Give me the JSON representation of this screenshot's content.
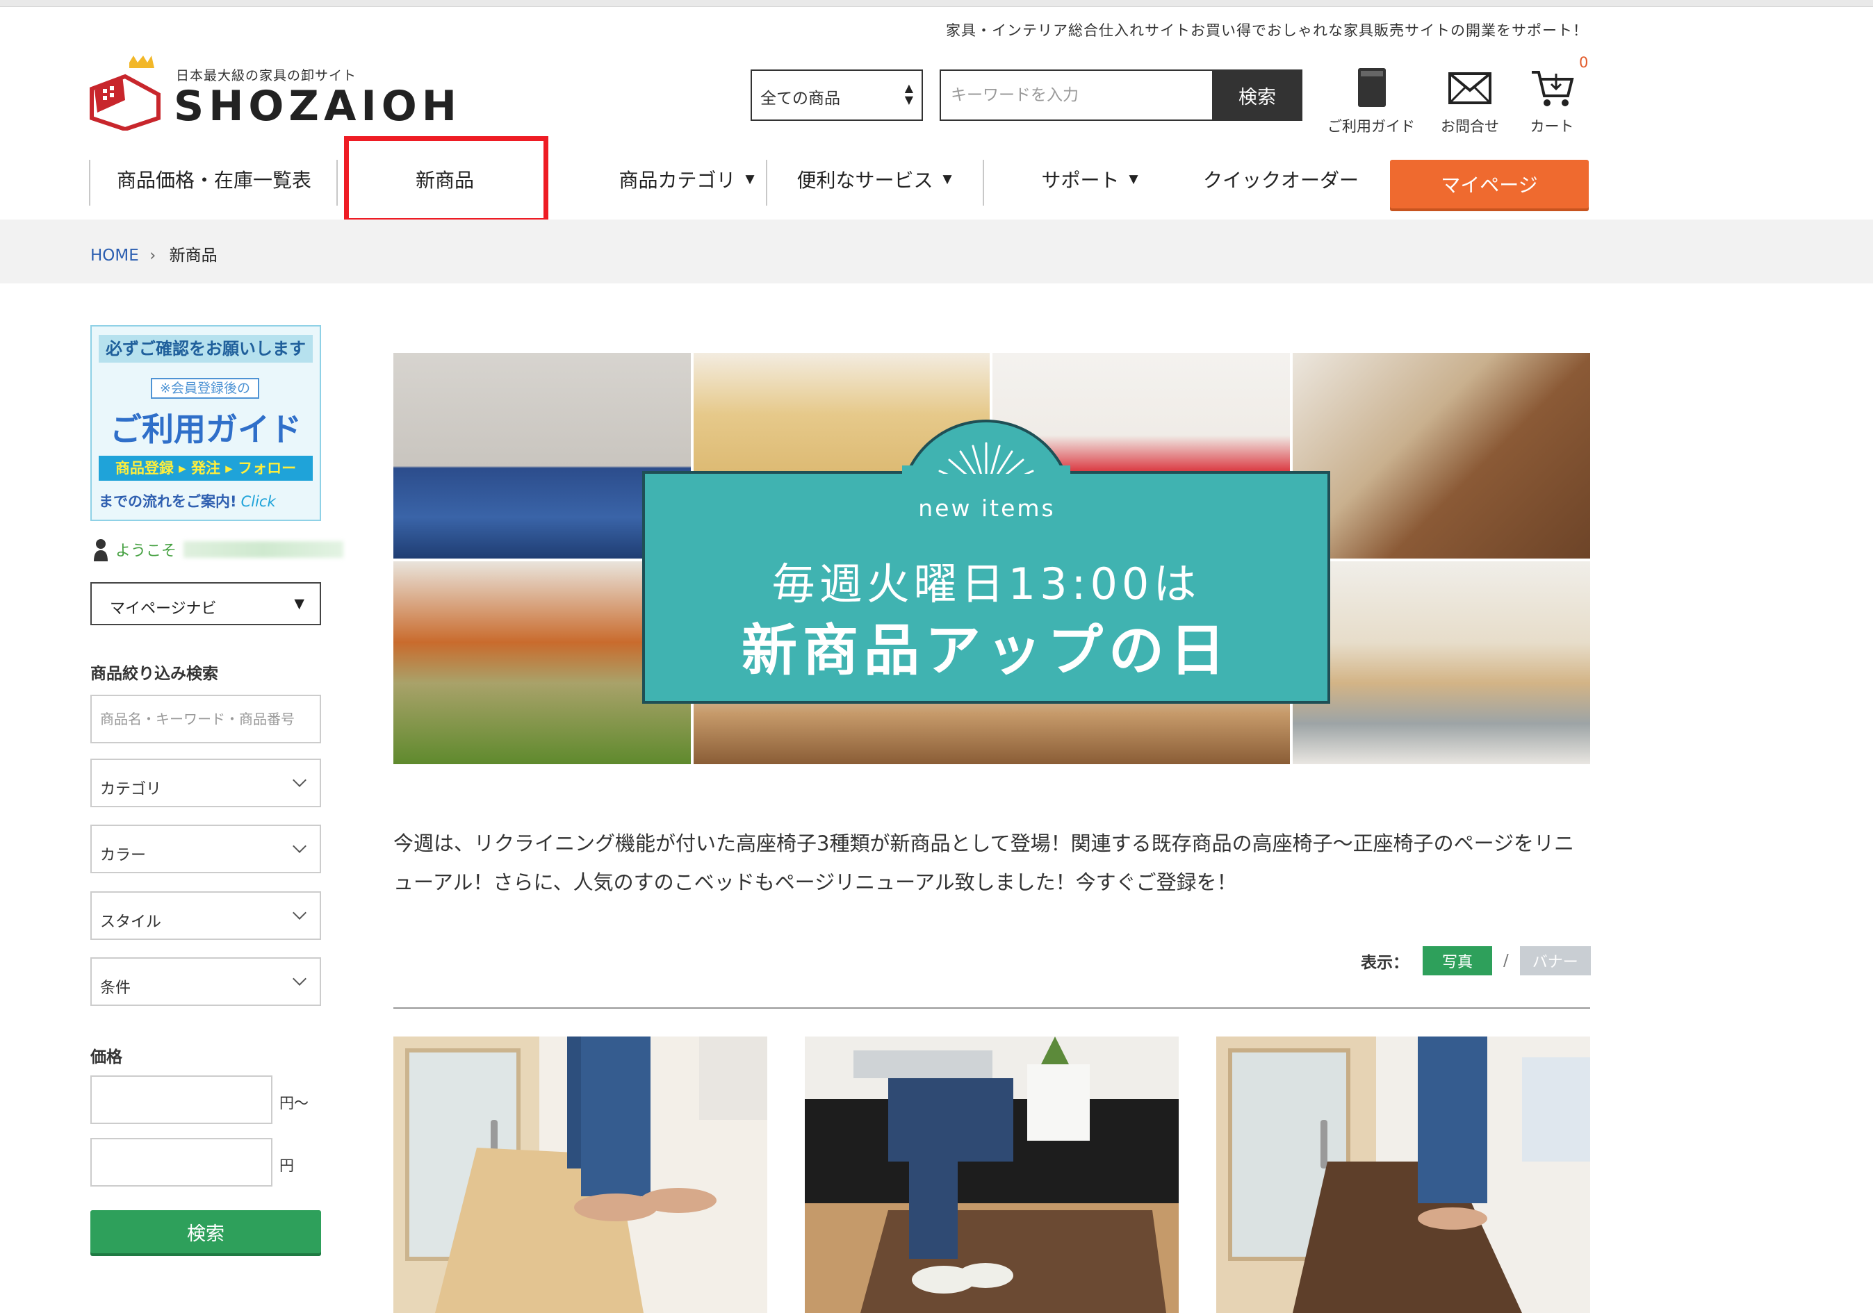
{
  "header": {
    "tagline": "家具・インテリア総合仕入れサイトお買い得でおしゃれな家具販売サイトの開業をサポート！",
    "logo_sub": "日本最大級の家具の卸サイト",
    "logo_name": "SHOZAIOH"
  },
  "search": {
    "category_value": "全ての商品",
    "keyword_placeholder": "キーワードを入力",
    "button_label": "検索"
  },
  "utility": {
    "guide_label": "ご利用ガイド",
    "contact_label": "お問合せ",
    "cart_label": "カート",
    "cart_count": "0"
  },
  "nav": {
    "items": [
      {
        "label": "商品価格・在庫一覧表"
      },
      {
        "label": "新商品"
      },
      {
        "label": "商品カテゴリ"
      },
      {
        "label": "便利なサービス"
      },
      {
        "label": "サポート"
      },
      {
        "label": "クイックオーダー"
      }
    ],
    "dropdown_arrow": "▼",
    "mypage_label": "マイページ"
  },
  "breadcrumb": {
    "home": "HOME",
    "separator": "›",
    "current": "新商品"
  },
  "sidebar": {
    "banner": {
      "top": "必ずご確認をお願いします",
      "small": "※会員登録後の",
      "title": "ご利用ガイド",
      "flow": "商品登録 ▸ 発注 ▸ フォロー",
      "bottom": "までの流れをご案内!",
      "click": "Click"
    },
    "welcome": "ようこそ",
    "mypage_nav": "マイページナビ",
    "mypage_caret": "▼",
    "filter_heading": "商品絞り込み検索",
    "filter_placeholder": "商品名・キーワード・商品番号",
    "filters": [
      "カテゴリ",
      "カラー",
      "スタイル",
      "条件"
    ],
    "price_heading": "価格",
    "price_from_unit": "円〜",
    "price_to_unit": "円",
    "search_label": "検索"
  },
  "hero": {
    "tag": "new items",
    "line1": "毎週火曜日13:00は",
    "line2": "新商品アップの日",
    "teal": "#40b3b1"
  },
  "intro": "今週は、リクライニング機能が付いた高座椅子3種類が新商品として登場！関連する既存商品の高座椅子〜正座椅子のページをリニューアル！さらに、人気のすのこベッドもページリニューアル致しました！今すぐご登録を！",
  "view_toggle": {
    "label": "表示：",
    "photo": "写真",
    "slash": "/",
    "banner": "バナー"
  },
  "colors": {
    "accent_orange": "#ef6a2f",
    "green": "#2ea05b",
    "highlight_red": "#ee1c24"
  }
}
